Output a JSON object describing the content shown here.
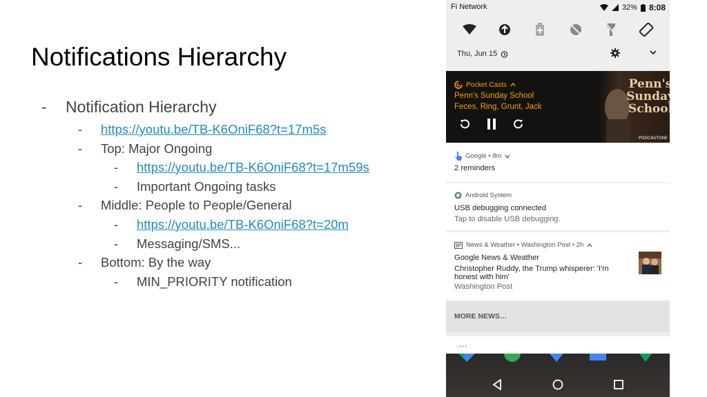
{
  "slide": {
    "title": "Notifications Hierarchy",
    "bullets": [
      {
        "level": 0,
        "text": "Notification Hierarchy",
        "link": false
      },
      {
        "level": 1,
        "text": "https://youtu.be/TB-K6OniF68?t=17m5s",
        "link": true
      },
      {
        "level": 1,
        "text": "Top: Major Ongoing",
        "link": false
      },
      {
        "level": 2,
        "text": "https://youtu.be/TB-K6OniF68?t=17m59s",
        "link": true
      },
      {
        "level": 2,
        "text": "Important Ongoing tasks",
        "link": false
      },
      {
        "level": 1,
        "text": "Middle: People to People/General",
        "link": false
      },
      {
        "level": 2,
        "text": "https://youtu.be/TB-K6OniF68?t=20m",
        "link": true
      },
      {
        "level": 2,
        "text": "Messaging/SMS...",
        "link": false
      },
      {
        "level": 1,
        "text": "Bottom: By the way",
        "link": false
      },
      {
        "level": 2,
        "text": "MIN_PRIORITY notification",
        "link": false
      }
    ],
    "dash": "-"
  },
  "phone": {
    "status": {
      "carrier": "Fi Network",
      "battery": "32%",
      "time": "8:08"
    },
    "quick_settings": [
      "wifi-icon",
      "data-saver-icon",
      "battery-saver-icon",
      "do-not-disturb-icon",
      "flashlight-icon",
      "auto-rotate-icon"
    ],
    "date_row": {
      "date": "Thu, Jun 15"
    },
    "media": {
      "app": "Pocket Casts",
      "title": "Penn's Sunday School",
      "artist": "Feces, Ring, Grunt, Jack",
      "art_text": [
        "Penn's",
        "Sunday",
        "School"
      ],
      "art_badge": "PODCASTONE"
    },
    "google": {
      "header": "Google • 8m",
      "body": "2 reminders"
    },
    "android": {
      "header": "Android System",
      "title": "USB debugging connected",
      "body": "Tap to disable USB debugging."
    },
    "news": {
      "header": "News & Weather • Washington Post • 2h",
      "title": "Google News & Weather",
      "line1": "Christopher Ruddy, the Trump whisperer: 'I'm",
      "line2": "honest with him'",
      "source": "Washington Post"
    },
    "more_news": "MORE NEWS…",
    "overflow": "…"
  },
  "colors": {
    "link": "#1f8bc4",
    "pocket_casts": "#f1a100",
    "google_blue": "#4285f4"
  }
}
